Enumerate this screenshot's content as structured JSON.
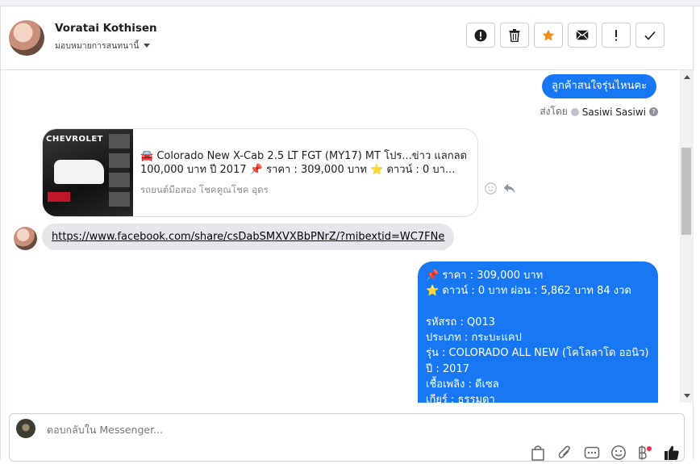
{
  "header": {
    "name": "Voratai Kothisen",
    "assign_label": "มอบหมายการสนทนานี้"
  },
  "messages": {
    "outgoing_1": "ลูกค้าสนใจรุ่นไหนคะ",
    "sent_by_prefix": "ส่งโดย",
    "sent_by_name": "Sasiwi Sasiwi",
    "card": {
      "thumb_brand": "CHEVROLET",
      "title": "🚘 Colorado New X-Cab 2.5 LT FGT (MY17) MT โปร...ข่าว แลกลด 100,000 บาท ปี 2017 📌 ราคา : 309,000 บาท ⭐ ดาวน์ : 0 บา...",
      "subtitle": "รถยนต์มือสอง โชคคูณโชค อุดร"
    },
    "link": "https://www.facebook.com/share/csDabSMXVXBbPNrZ/?mibextid=WC7FNe",
    "outgoing_2_lines": [
      "📌 ราคา : 309,000 บาท",
      "⭐ ดาวน์ : 0 บาท ผ่อน : 5,862 บาท 84 งวด",
      "",
      "รหัสรถ : Q013",
      "ประเภท : กระบะแคป",
      "รุ่น : COLORADO ALL NEW (โคโลลาโด ออนิว)",
      "ปี : 2017",
      "เชื้อเพลิง : ดีเซล",
      "เกียร์ : ธรรมดา"
    ]
  },
  "composer": {
    "placeholder": "ตอบกลับใน Messenger..."
  },
  "colors": {
    "accent": "#1877f2",
    "star": "#f28c1a",
    "incoming_bg": "#e4e6eb"
  },
  "icons": {
    "actions": [
      "alert-circle-icon",
      "trash-icon",
      "star-icon",
      "envelope-icon",
      "exclamation-icon",
      "check-icon"
    ],
    "composer_tools": [
      "shopping-bag-icon",
      "paperclip-icon",
      "saved-reply-icon",
      "emoji-icon",
      "baht-icon",
      "thumbs-up-icon"
    ]
  }
}
